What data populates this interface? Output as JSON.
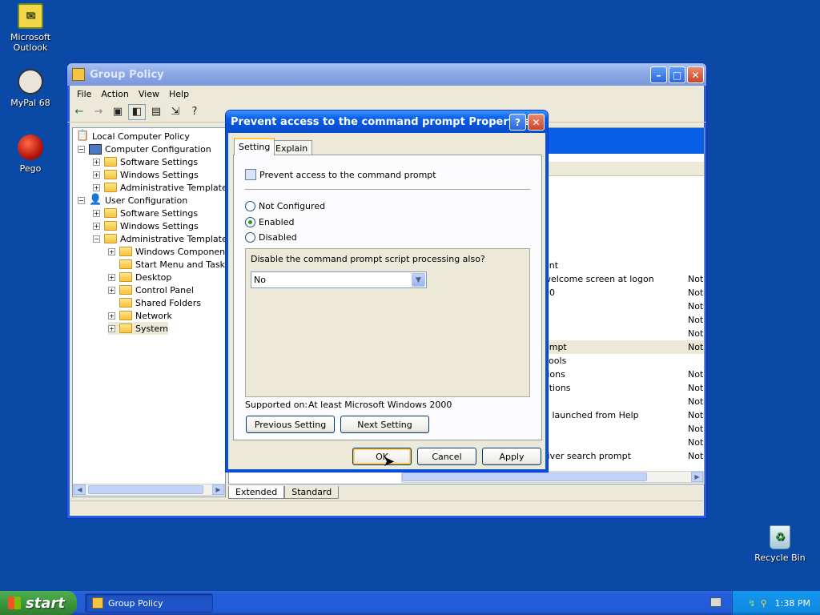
{
  "desktop": {
    "icons": [
      {
        "label_line1": "Microsoft",
        "label_line2": "Outlook"
      },
      {
        "label_line1": "MyPal 68",
        "label_line2": ""
      },
      {
        "label_line1": "Pego",
        "label_line2": ""
      },
      {
        "label_line1": "Recycle Bin",
        "label_line2": ""
      }
    ]
  },
  "window": {
    "title": "Group Policy",
    "menu": [
      "File",
      "Action",
      "View",
      "Help"
    ],
    "tree": [
      {
        "label": "Local Computer Policy"
      },
      {
        "label": "Computer Configuration"
      },
      {
        "label": "Software Settings"
      },
      {
        "label": "Windows Settings"
      },
      {
        "label": "Administrative Templates"
      },
      {
        "label": "User Configuration"
      },
      {
        "label": "Software Settings"
      },
      {
        "label": "Windows Settings"
      },
      {
        "label": "Administrative Templates"
      },
      {
        "label": "Windows Components"
      },
      {
        "label": "Start Menu and Taskbar"
      },
      {
        "label": "Desktop"
      },
      {
        "label": "Control Panel"
      },
      {
        "label": "Shared Folders"
      },
      {
        "label": "Network"
      },
      {
        "label": "System"
      }
    ],
    "right_rows": [
      {
        "text": "ent",
        "state": ""
      },
      {
        "text": "welcome screen at logon",
        "state": "Not"
      },
      {
        "text": "00",
        "state": "Not"
      },
      {
        "text": "",
        "state": "Not"
      },
      {
        "text": "",
        "state": "Not"
      },
      {
        "text": "",
        "state": "Not"
      },
      {
        "text": "ompt",
        "state": "Not"
      },
      {
        "text": "cools",
        "state": ""
      },
      {
        "text": "tions",
        "state": "Not"
      },
      {
        "text": "ations",
        "state": "Not"
      },
      {
        "text": "",
        "state": "Not"
      },
      {
        "text": "g launched from Help",
        "state": "Not"
      },
      {
        "text": "s",
        "state": "Not"
      },
      {
        "text": "",
        "state": "Not"
      },
      {
        "text": "river search prompt",
        "state": "Not"
      }
    ],
    "bottom_tabs": [
      "Extended",
      "Standard"
    ]
  },
  "dialog": {
    "title": "Prevent access to the command prompt Properties",
    "tabs": [
      "Setting",
      "Explain"
    ],
    "policy_name": "Prevent access to the command prompt",
    "options": [
      "Not Configured",
      "Enabled",
      "Disabled"
    ],
    "selected_option": "Enabled",
    "option_label": "Disable the command prompt script processing also?",
    "option_value": "No",
    "supported_label": "Supported on:",
    "supported_value": "At least Microsoft Windows 2000",
    "prev_button": "Previous Setting",
    "next_button": "Next Setting",
    "ok_button": "OK",
    "cancel_button": "Cancel",
    "apply_button": "Apply"
  },
  "taskbar": {
    "start_label": "start",
    "task_label": "Group Policy",
    "clock": "1:38 PM"
  },
  "colors": {
    "desktop": "#0a4aa6",
    "titlebar_active": "#0852d6",
    "selection": "#0a5fe8"
  }
}
